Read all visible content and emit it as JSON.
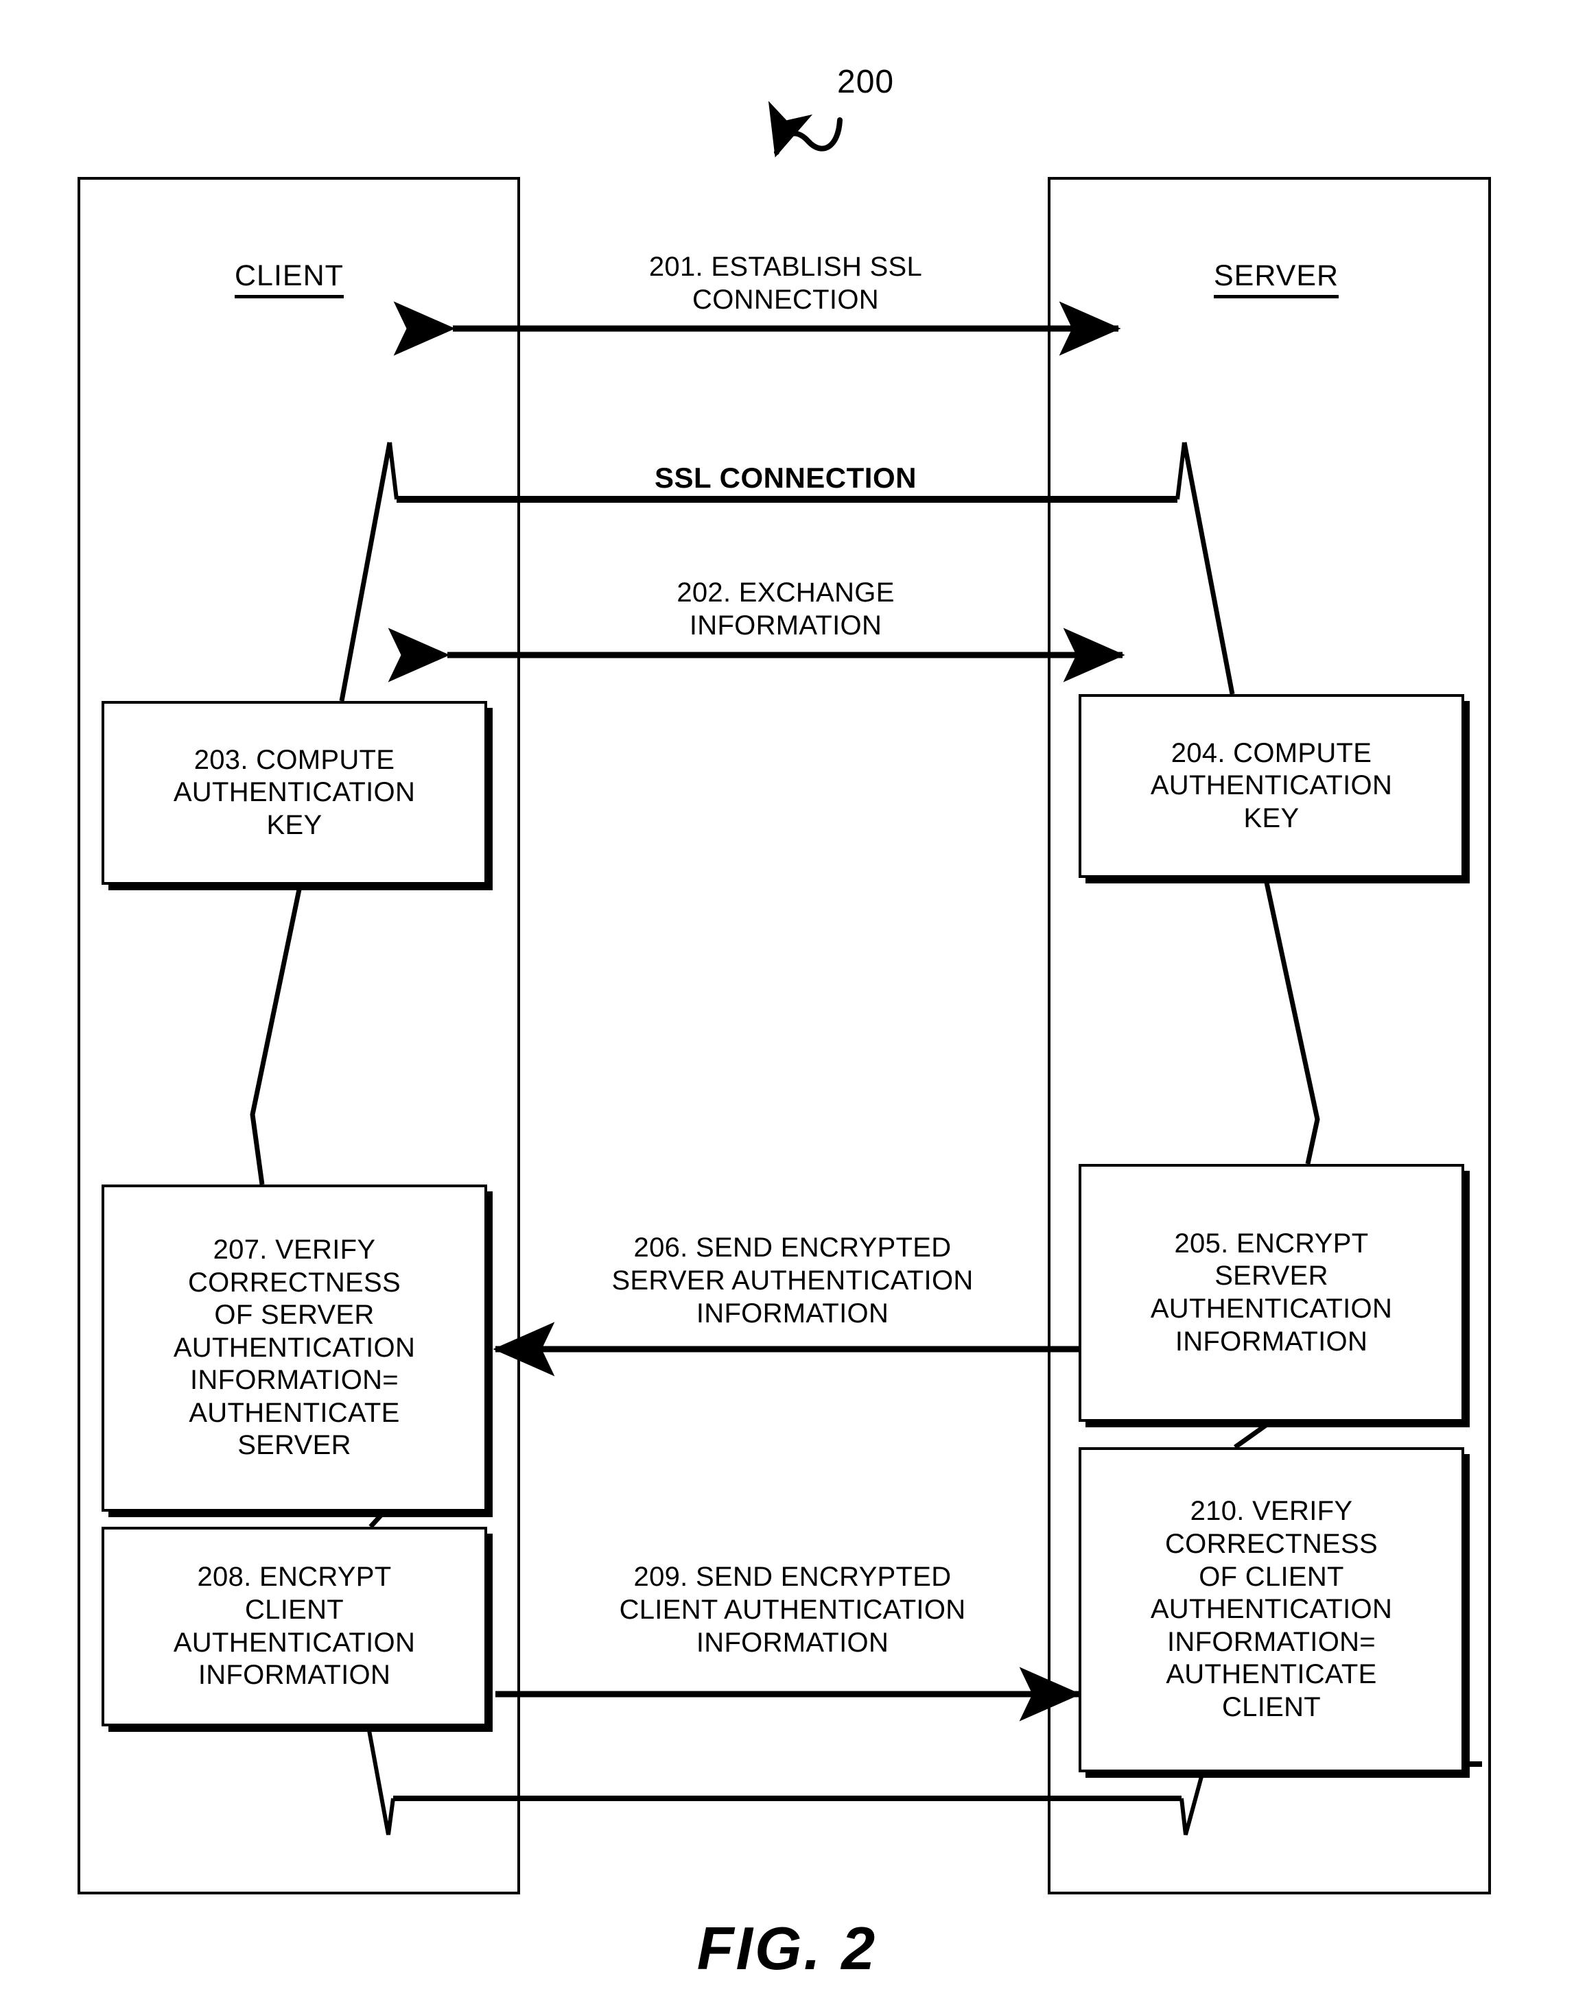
{
  "figure": {
    "reference_numeral": "200",
    "caption": "FIG. 2"
  },
  "lanes": [
    {
      "id": "client",
      "title": "CLIENT"
    },
    {
      "id": "server",
      "title": "SERVER"
    }
  ],
  "messages": [
    {
      "id": "201",
      "label": "201. ESTABLISH SSL\nCONNECTION",
      "direction": "bidirectional"
    },
    {
      "id": "ssl",
      "label": "SSL CONNECTION",
      "direction": "bracket"
    },
    {
      "id": "202",
      "label": "202. EXCHANGE\nINFORMATION",
      "direction": "bidirectional"
    },
    {
      "id": "206",
      "label": "206. SEND ENCRYPTED\nSERVER AUTHENTICATION\nINFORMATION",
      "direction": "server-to-client"
    },
    {
      "id": "209",
      "label": "209. SEND ENCRYPTED\nCLIENT AUTHENTICATION\nINFORMATION",
      "direction": "client-to-server"
    }
  ],
  "boxes": [
    {
      "id": "203",
      "lane": "client",
      "label": "203. COMPUTE\nAUTHENTICATION\nKEY"
    },
    {
      "id": "204",
      "lane": "server",
      "label": "204. COMPUTE\nAUTHENTICATION\nKEY"
    },
    {
      "id": "207",
      "lane": "client",
      "label": "207. VERIFY\nCORRECTNESS\nOF SERVER\nAUTHENTICATION\nINFORMATION=\nAUTHENTICATE\nSERVER"
    },
    {
      "id": "205",
      "lane": "server",
      "label": "205. ENCRYPT\nSERVER\nAUTHENTICATION\nINFORMATION"
    },
    {
      "id": "208",
      "lane": "client",
      "label": "208. ENCRYPT\nCLIENT\nAUTHENTICATION\nINFORMATION"
    },
    {
      "id": "210",
      "lane": "server",
      "label": "210. VERIFY\nCORRECTNESS\nOF CLIENT\nAUTHENTICATION\nINFORMATION=\nAUTHENTICATE\nCLIENT"
    }
  ],
  "colors": {
    "ink": "#000000",
    "background": "#ffffff"
  }
}
